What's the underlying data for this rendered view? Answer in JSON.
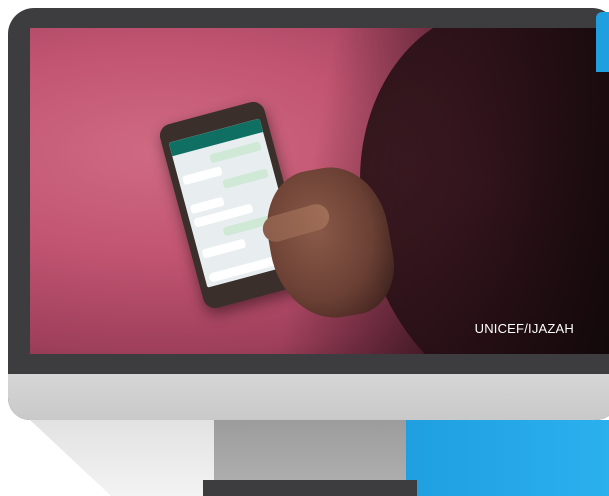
{
  "photo": {
    "credit": "UNICEF/IJAZAH",
    "subject_icon": "smartphone-chat-icon"
  },
  "colors": {
    "bezel": "#3d3d3f",
    "chin": "#d0d0d0",
    "stand": "#a5a5a5",
    "accent": "#1f9fe0",
    "backdrop": "#c25572"
  }
}
